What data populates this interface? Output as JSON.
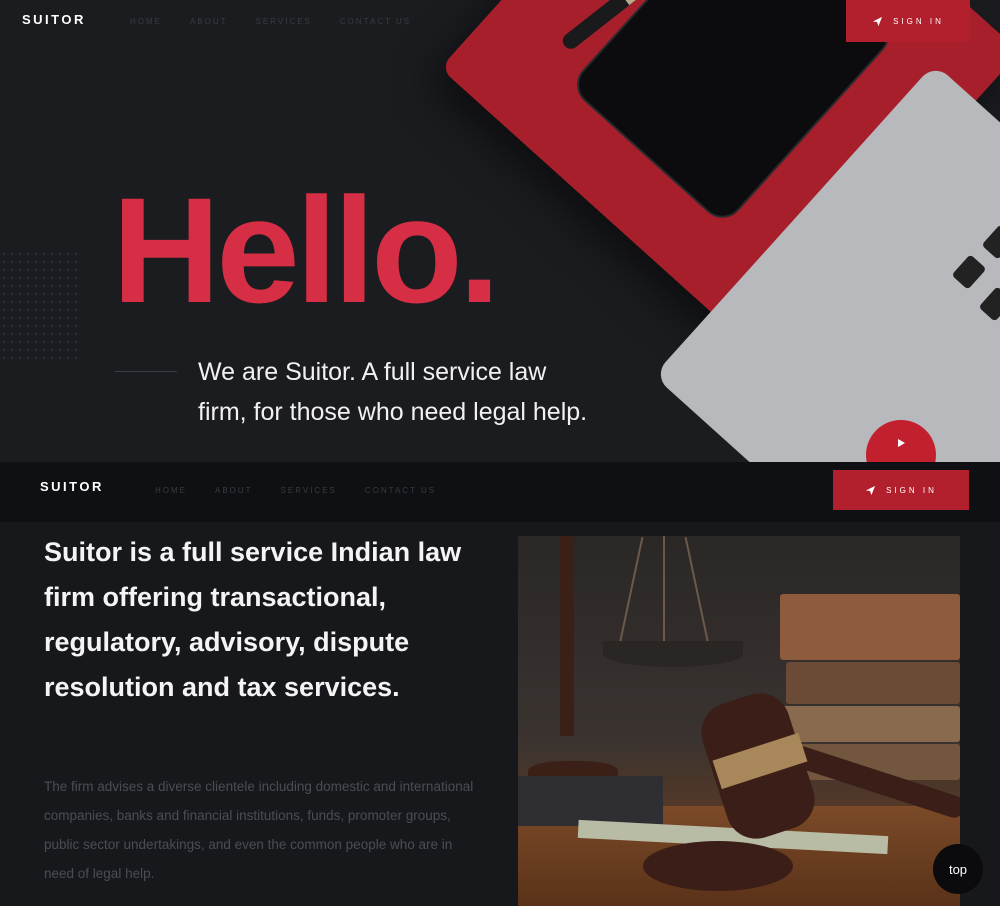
{
  "brand": "SUITOR",
  "nav": {
    "links": [
      "HOME",
      "ABOUT",
      "SERVICES",
      "CONTACT US"
    ],
    "signin_label": "SIGN IN"
  },
  "hero": {
    "headline": "Hello.",
    "tagline": "We are Suitor. A full service law firm, for those who need legal help."
  },
  "about": {
    "title": "Suitor is a full service Indian law firm offering transactional, regulatory, advisory, dispute resolution and tax services.",
    "description": "The firm advises a diverse clientele including domestic and international companies, banks and financial institutions, funds, promoter groups, public sector undertakings, and even the common people who are in need of legal help."
  },
  "back_to_top_label": "top",
  "colors": {
    "accent": "#d62e44",
    "button": "#b3202d",
    "background": "#17181c"
  },
  "icons": {
    "signin": "paper-plane-icon",
    "play": "play-icon"
  }
}
